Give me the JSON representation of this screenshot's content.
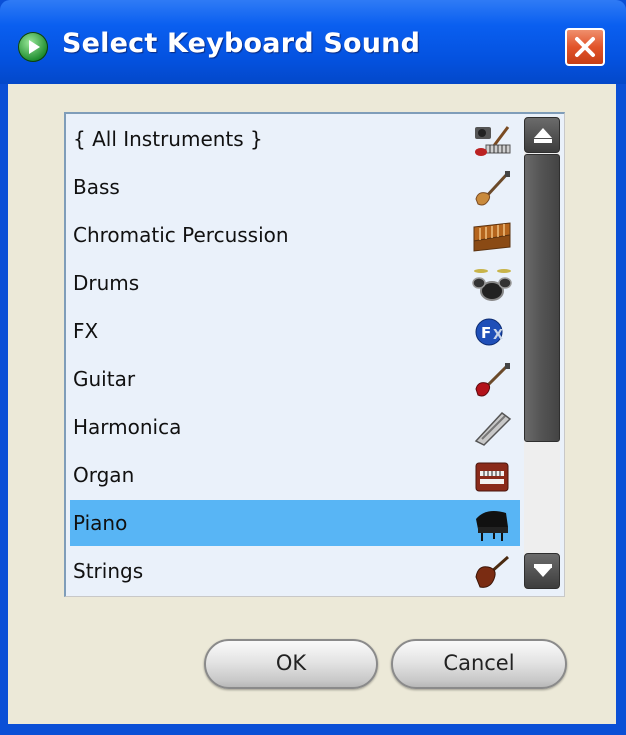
{
  "window": {
    "title": "Select Keyboard Sound",
    "icon": "green-play-icon",
    "close_icon": "close-icon"
  },
  "list": {
    "items": [
      {
        "label": "{ All Instruments }",
        "icon": "all-instruments-icon"
      },
      {
        "label": "Bass",
        "icon": "bass-icon"
      },
      {
        "label": "Chromatic Percussion",
        "icon": "chromatic-percussion-icon"
      },
      {
        "label": "Drums",
        "icon": "drums-icon"
      },
      {
        "label": "FX",
        "icon": "fx-icon"
      },
      {
        "label": "Guitar",
        "icon": "guitar-icon"
      },
      {
        "label": "Harmonica",
        "icon": "harmonica-icon"
      },
      {
        "label": "Organ",
        "icon": "organ-icon"
      },
      {
        "label": "Piano",
        "icon": "piano-icon"
      },
      {
        "label": "Strings",
        "icon": "strings-icon"
      }
    ],
    "selected": "Piano"
  },
  "buttons": {
    "ok": "OK",
    "cancel": "Cancel"
  },
  "colors": {
    "titlebar": "#0a5ff0",
    "selection": "#58b5f5",
    "list_background": "#eaf1fa",
    "dialog_background": "#ece9d8"
  }
}
